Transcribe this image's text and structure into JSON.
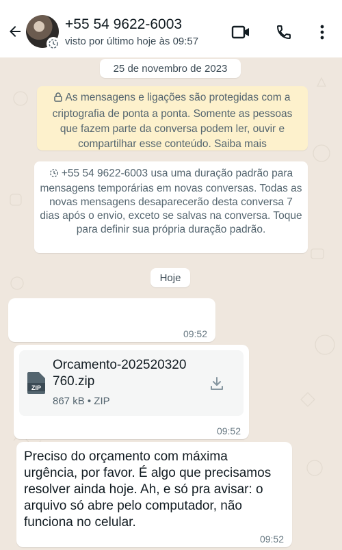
{
  "header": {
    "contact_name": "+55 54 9622-6003",
    "last_seen": "visto por último hoje às 09:57",
    "icons": [
      "back-arrow-icon",
      "timer-icon",
      "video-call-icon",
      "phone-icon",
      "more-options-icon"
    ]
  },
  "chat": {
    "date_label": "25 de novembro de 2023",
    "encryption_notice": "As mensagens e ligações são protegidas com a criptografia de ponta a ponta. Somente as pessoas que fazem parte da conversa podem ler, ouvir e compartilhar esse conteúdo. Saiba mais",
    "temporary_notice": "+55 54 9622-6003 usa uma duração padrão para mensagens temporárias em novas conversas. Todas as novas mensagens desaparecerão desta conversa 7 dias após o envio, exceto se salvas na conversa. Toque para definir sua própria duração padrão.",
    "today_label": "Hoje",
    "messages": [
      {
        "type": "text",
        "text": "",
        "time": "09:52"
      },
      {
        "type": "file",
        "file_name": "Orcamento-202520320760.zip",
        "file_name_line1": "Orcamento-202520320",
        "file_name_line2": "760.zip",
        "file_meta": "867 kB • ZIP",
        "file_badge": "ZIP",
        "time": "09:52"
      },
      {
        "type": "text",
        "text": "Preciso do orçamento com máxima urgência, por favor. É algo que precisamos resolver ainda hoje. Ah, e só pra avisar: o arquivo só abre pelo computador, não funciona no celular.",
        "time": "09:52"
      }
    ]
  },
  "colors": {
    "chat_background": "#efe7de",
    "encryption_notice_bg": "#fdf1cc",
    "bubble_bg": "#ffffff",
    "header_bg": "#ffffff",
    "time_text": "#667781",
    "icon_color": "#111b21"
  }
}
